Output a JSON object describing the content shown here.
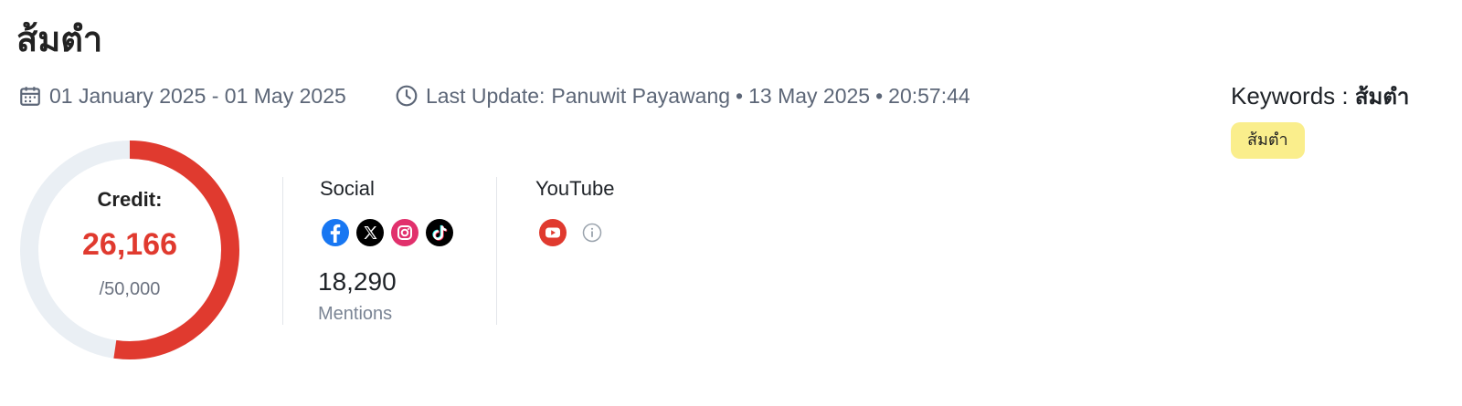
{
  "header": {
    "title": "ส้มตำ"
  },
  "meta": {
    "date_range": "01 January 2025 - 01 May 2025",
    "last_update_label": "Last Update:",
    "last_update_user": "Panuwit Payawang",
    "last_update_date": "13 May 2025",
    "last_update_time": "20:57:44",
    "separator": "•"
  },
  "keywords": {
    "label": "Keywords :",
    "value": "ส้มตำ",
    "chips": [
      "ส้มตำ"
    ]
  },
  "credit": {
    "label": "Credit:",
    "used": "26,166",
    "total": "/50,000",
    "used_fraction": 0.5233
  },
  "social": {
    "title": "Social",
    "platforms": [
      "facebook-icon",
      "x-icon",
      "instagram-icon",
      "tiktok-icon"
    ],
    "mentions_value": "18,290",
    "mentions_label": "Mentions"
  },
  "youtube": {
    "title": "YouTube",
    "platforms": [
      "youtube-icon",
      "info-icon"
    ]
  },
  "colors": {
    "accent_red": "#e03a2f",
    "track": "#eaeff4",
    "chip_bg": "#faee8c",
    "muted_text": "#5c6677"
  }
}
